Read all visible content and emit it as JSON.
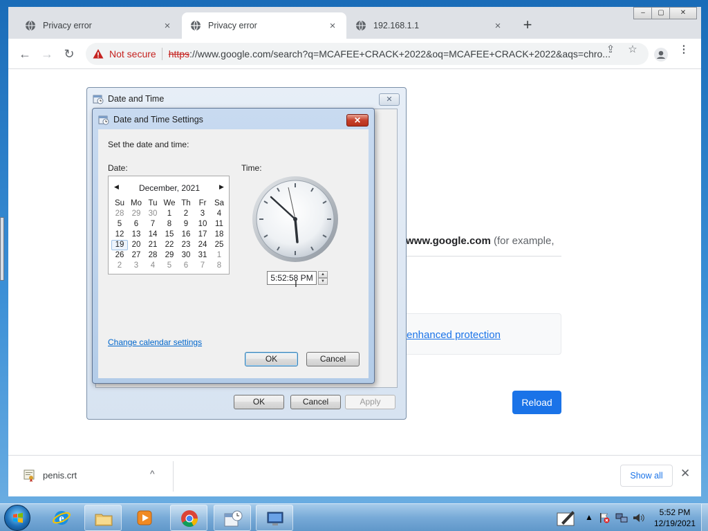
{
  "browser": {
    "tabs": [
      {
        "title": "Privacy error",
        "close": "×",
        "active": false
      },
      {
        "title": "Privacy error",
        "close": "×",
        "active": true
      },
      {
        "title": "192.168.1.1",
        "close": "×",
        "active": false
      }
    ],
    "new_tab": "+",
    "window_controls": {
      "minimize": "–",
      "maximize": "▢",
      "close": "✕"
    },
    "nav": {
      "back": "←",
      "forward": "→",
      "reload": "↻"
    },
    "omnibox": {
      "security_label": "Not secure",
      "scheme": "https",
      "url_rest": "://www.google.com/search?q=MCAFEE+CRACK+2022&oq=MCAFEE+CRACK+2022&aqs=chro..."
    },
    "page": {
      "body_domain": "www.google.com",
      "body_rest": " (for example,",
      "enhanced_link": "enhanced protection",
      "reload_button": "Reload"
    },
    "downloads": {
      "file_name": "penis.crt",
      "chevron": "^",
      "show_all": "Show all",
      "close": "✕"
    }
  },
  "date_time_dialog": {
    "title": "Date and Time",
    "close": "✕",
    "buttons": {
      "ok": "OK",
      "cancel": "Cancel",
      "apply": "Apply"
    }
  },
  "settings_dialog": {
    "title": "Date and Time Settings",
    "close": "✕",
    "instruction": "Set the date and time:",
    "date_label": "Date:",
    "time_label": "Time:",
    "calendar": {
      "month": "December, 2021",
      "prev": "◀",
      "next": "▶",
      "weekdays": [
        "Su",
        "Mo",
        "Tu",
        "We",
        "Th",
        "Fr",
        "Sa"
      ],
      "weeks": [
        [
          "28",
          "29",
          "30",
          "1",
          "2",
          "3",
          "4"
        ],
        [
          "5",
          "6",
          "7",
          "8",
          "9",
          "10",
          "11"
        ],
        [
          "12",
          "13",
          "14",
          "15",
          "16",
          "17",
          "18"
        ],
        [
          "19",
          "20",
          "21",
          "22",
          "23",
          "24",
          "25"
        ],
        [
          "26",
          "27",
          "28",
          "29",
          "30",
          "31",
          "1"
        ],
        [
          "2",
          "3",
          "4",
          "5",
          "6",
          "7",
          "8"
        ]
      ],
      "selected_day": "19"
    },
    "time_value": "5:52:58 PM",
    "change_calendar_link": "Change calendar settings",
    "buttons": {
      "ok": "OK",
      "cancel": "Cancel"
    }
  },
  "taskbar": {
    "pinned": [
      "internet-explorer",
      "file-explorer",
      "media-player",
      "chrome",
      "date-time-control-panel",
      "remote-desktop"
    ],
    "tray_chevron": "▲",
    "clock_time": "5:52 PM",
    "clock_date": "12/19/2021"
  }
}
